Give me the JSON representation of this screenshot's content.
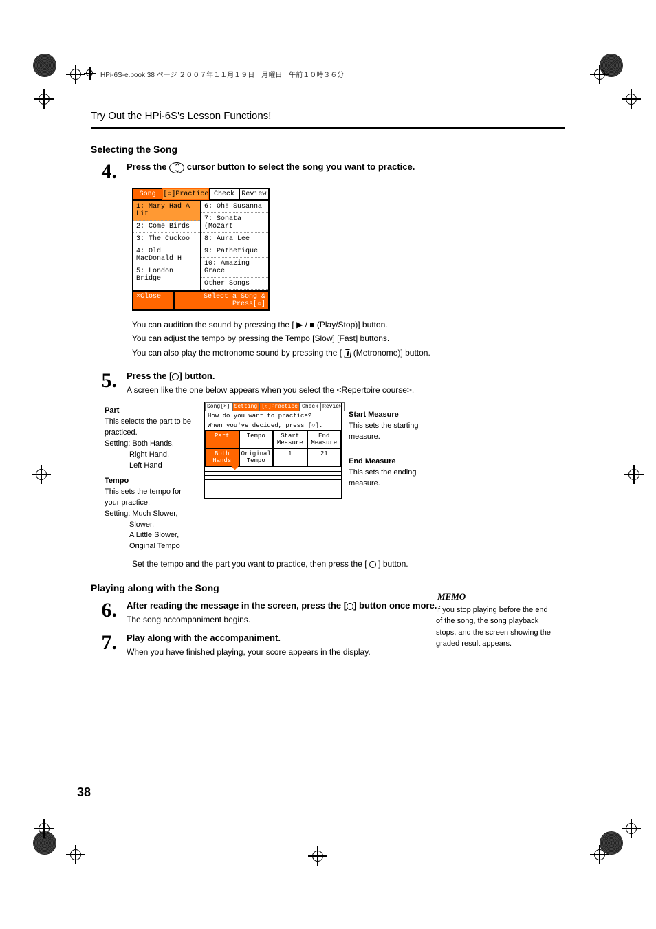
{
  "meta_header": "HPi-6S-e.book 38 ページ ２００７年１１月１９日　月曜日　午前１０時３６分",
  "title": "Try Out the HPi-6S's Lesson Functions!",
  "section1": "Selecting the Song",
  "step4_num": "4.",
  "step4_text_a": "Press the",
  "step4_text_b": "cursor button to select the song you want to practice.",
  "lcd1": {
    "tabs": [
      "Song",
      "[○]Practice",
      "Check",
      "Review"
    ],
    "left": [
      "1: Mary Had A Lit",
      "2: Come Birds",
      "3: The Cuckoo",
      "4: Old MacDonald H",
      "5: London Bridge"
    ],
    "right": [
      "6: Oh! Susanna",
      "7: Sonata (Mozart",
      "8: Aura Lee",
      "9: Pathetique",
      "10: Amazing Grace",
      "Other Songs"
    ],
    "close": "×Close",
    "foot": "Select a Song & Press[○]"
  },
  "notes4": [
    "You can audition the sound by pressing the [ ▶/■  (Play/Stop)] button.",
    "You can adjust the tempo by pressing the Tempo [Slow] [Fast] buttons.",
    "You can also play the metronome sound by pressing the [ △ (Metronome)] button."
  ],
  "step5_num": "5.",
  "step5_text_a": "Press the [",
  "step5_text_b": "] button.",
  "step5_sub": "A screen like the one below appears when you select the <Repertoire course>.",
  "part": {
    "hd": "Part",
    "desc": "This selects the part to be practiced.",
    "setting_label": "Setting: Both Hands,",
    "setting2": "Right Hand,",
    "setting3": "Left Hand",
    "tempo_hd": "Tempo",
    "tempo_desc": "This sets the tempo for your practice.",
    "tempo_setting_label": "Setting:  Much Slower,",
    "tempo_s2": "Slower,",
    "tempo_s3": "A Little Slower,",
    "tempo_s4": "Original Tempo"
  },
  "lcd2": {
    "tabs": [
      "Song[×]",
      "Setting",
      "[○]Practice",
      "Check",
      "Review"
    ],
    "line1": "How do you want to practice?",
    "line2": "When you've decided, press [○].",
    "cols": [
      "Part",
      "Tempo",
      "Start Measure",
      "End Measure"
    ],
    "vals": [
      "Both Hands",
      "Original Tempo",
      "1",
      "21"
    ]
  },
  "right": {
    "sm_hd": "Start Measure",
    "sm_desc": "This sets the starting measure.",
    "em_hd": "End Measure",
    "em_desc": "This sets the ending measure."
  },
  "foot_instr": "Set the tempo and the part you want to practice, then press the [ ○ ] button.",
  "section2": "Playing along with the Song",
  "step6_num": "6.",
  "step6_text_a": "After reading the message in the screen, press the [",
  "step6_text_b": "] button once more.",
  "step6_sub": "The song accompaniment begins.",
  "step7_num": "7.",
  "step7_text": "Play along with the accompaniment.",
  "step7_sub": "When you have finished playing, your score appears in the display.",
  "memo_label": "MEMO",
  "memo_text": "If you stop playing before the end of the song, the song playback stops, and the screen showing the graded result appears.",
  "page_number": "38"
}
